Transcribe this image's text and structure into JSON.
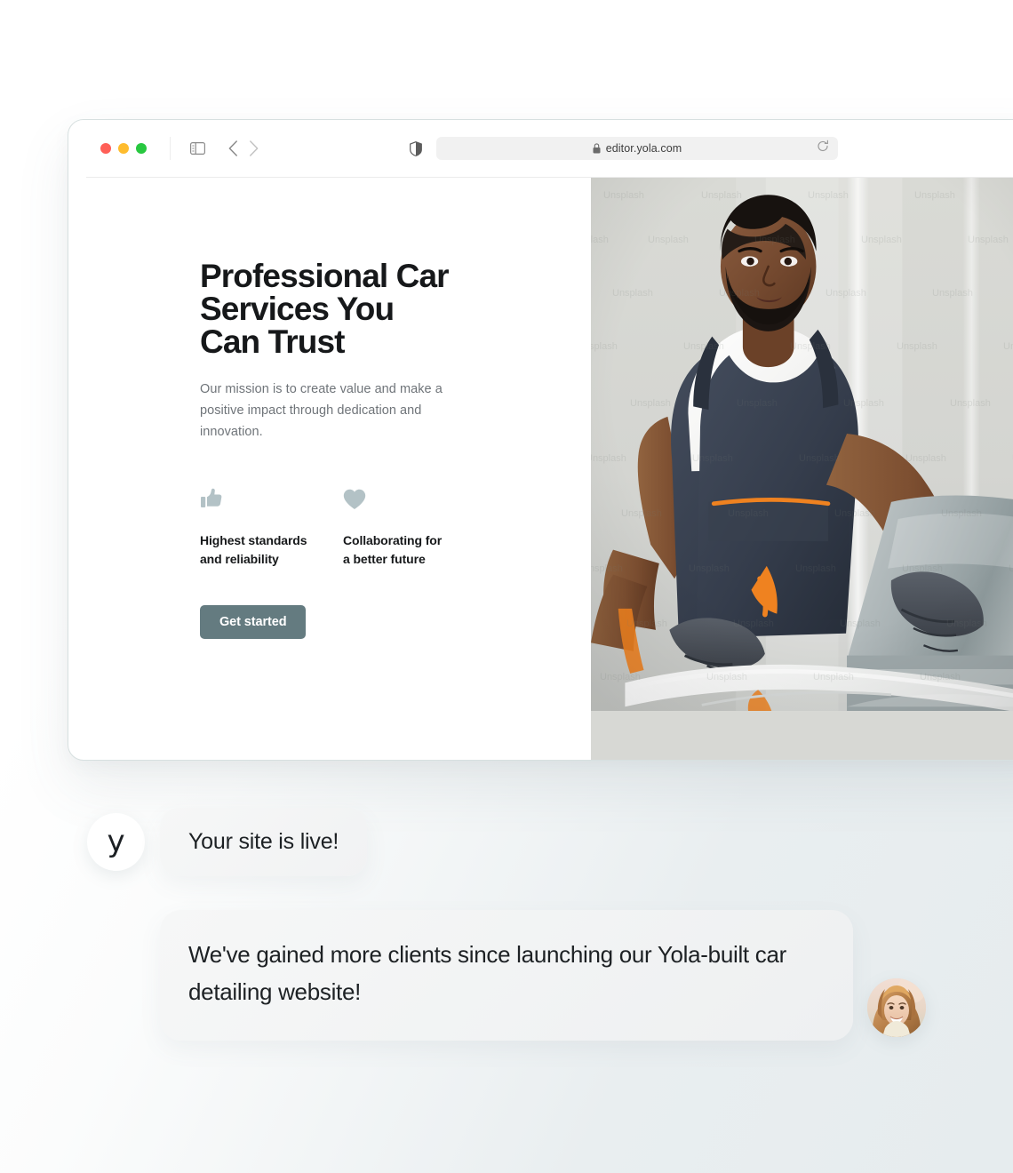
{
  "browser": {
    "traffic_lights": [
      {
        "name": "close",
        "color": "#ff5f57"
      },
      {
        "name": "minimize",
        "color": "#febc2e"
      },
      {
        "name": "maximize",
        "color": "#28c840"
      }
    ],
    "sidebar_icon": "sidebar-toggle-icon",
    "back_icon": "chevron-left-icon",
    "forward_icon": "chevron-right-icon",
    "shield_icon": "privacy-shield-icon",
    "lock_icon": "lock-icon",
    "url": "editor.yola.com",
    "reload_icon": "reload-icon"
  },
  "site": {
    "hero": {
      "title": "Professional Car\nServices You\nCan Trust",
      "subtitle": "Our mission is to create value and make a positive impact through dedication and innovation.",
      "cta_label": "Get started",
      "features": [
        {
          "icon": "thumbs-up-icon",
          "label": "Highest standards\nand reliability"
        },
        {
          "icon": "heart-icon",
          "label": "Collaborating for\na better future"
        }
      ],
      "image_alt": "Car detailer polishing a vehicle",
      "image_watermark": "Unsplash"
    }
  },
  "chat": {
    "brand_logo_letter": "y",
    "messages": [
      {
        "from": "yola",
        "text": "Your site is live!"
      },
      {
        "from": "customer",
        "text": "We've gained more clients since launching our Yola-built car detailing website!"
      }
    ],
    "customer_avatar": "customer-photo-avatar"
  },
  "colors": {
    "accent_button": "#647b80",
    "feature_icon": "#b3c2c6",
    "heading": "#16181a",
    "body_text": "#6f7479",
    "bubble_bg": "#f4f5f5"
  }
}
